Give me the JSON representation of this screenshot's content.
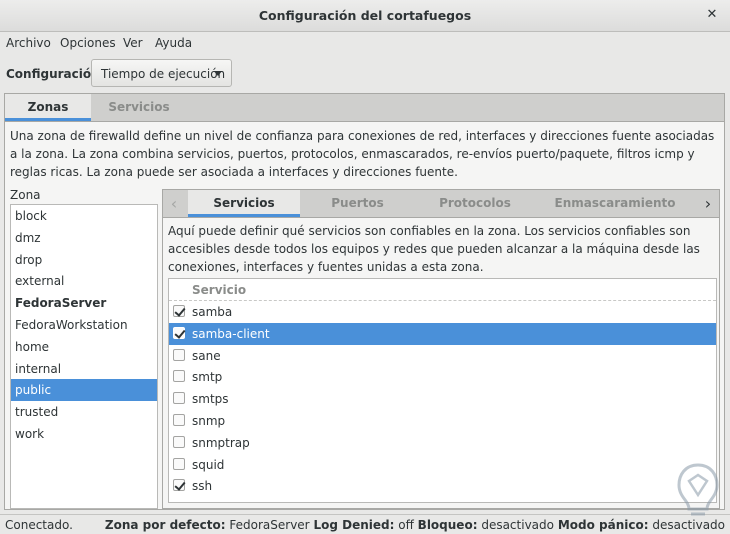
{
  "window": {
    "title": "Configuración del cortafuegos",
    "close_glyph": "✕"
  },
  "menubar": {
    "items": [
      "Archivo",
      "Opciones",
      "Ver",
      "Ayuda"
    ]
  },
  "config": {
    "label": "Configuración:",
    "selected": "Tiempo de ejecución"
  },
  "main_tabs": [
    "Zonas",
    "Servicios"
  ],
  "zone_description": "Una zona de firewalld define un nivel de confianza para conexiones de red, interfaces y direcciones fuente asociadas a la zona. La zona combina servicios, puertos, protocolos, enmascarados, re-envíos puerto/paquete, filtros icmp y reglas ricas. La zona puede ser asociada a interfaces y direcciones fuente.",
  "zone_list": {
    "header": "Zona",
    "items": [
      "block",
      "dmz",
      "drop",
      "external",
      "FedoraServer",
      "FedoraWorkstation",
      "home",
      "internal",
      "public",
      "trusted",
      "work"
    ],
    "selected": "public",
    "default": "FedoraServer"
  },
  "zone_tabs": {
    "items": [
      "Servicios",
      "Puertos",
      "Protocolos",
      "Enmascaramiento"
    ],
    "active": "Servicios",
    "prev_glyph": "‹",
    "next_glyph": "›"
  },
  "service_description": "Aquí puede definir qué servicios son confiables en la zona. Los servicios confiables son accesibles desde todos los equipos y redes que pueden alcanzar a la máquina desde las conexiones, interfaces y fuentes unidas a esta zona.",
  "services": {
    "column_header": "Servicio",
    "rows": [
      {
        "name": "samba",
        "checked": true
      },
      {
        "name": "samba-client",
        "checked": true,
        "selected": true
      },
      {
        "name": "sane",
        "checked": false
      },
      {
        "name": "smtp",
        "checked": false
      },
      {
        "name": "smtps",
        "checked": false
      },
      {
        "name": "snmp",
        "checked": false
      },
      {
        "name": "snmptrap",
        "checked": false
      },
      {
        "name": "squid",
        "checked": false
      },
      {
        "name": "ssh",
        "checked": true
      }
    ]
  },
  "statusbar": {
    "connection": "Conectado.",
    "default_zone_label": "Zona por defecto:",
    "default_zone_value": "FedoraServer",
    "log_denied_label": "Log Denied:",
    "log_denied_value": "off",
    "lockdown_label": "Bloqueo:",
    "lockdown_value": "desactivado",
    "panic_label": "Modo pánico:",
    "panic_value": "desactivado"
  },
  "colors": {
    "accent": "#4a90d9",
    "window_bg": "#e8e8e7",
    "tab_bar": "#cfcfcd"
  }
}
